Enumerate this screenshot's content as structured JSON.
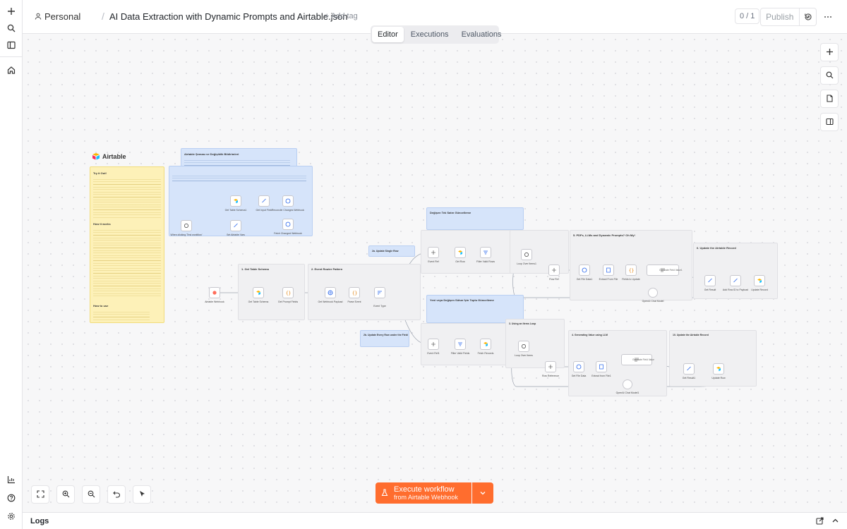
{
  "breadcrumb": {
    "project": "Personal",
    "separator": "/",
    "workflow_title": "AI Data Extraction with Dynamic Prompts and Airtable.json",
    "add_tag": "+ Add tag"
  },
  "header": {
    "version_counter": "0 / 1",
    "publish_label": "Publish"
  },
  "tabs": [
    {
      "label": "Editor",
      "active": true
    },
    {
      "label": "Executions",
      "active": false
    },
    {
      "label": "Evaluations",
      "active": false
    }
  ],
  "execute": {
    "label": "Execute workflow",
    "sublabel": "from Airtable Webhook"
  },
  "logs": {
    "label": "Logs"
  },
  "workflow": {
    "airtable_logo": "Airtable",
    "sticky_try_it": "Try it Out!",
    "sticky_how_it_works": "How it works",
    "sticky_how_to_use": "How to use",
    "sticky_airtable_sema": "Airtable Şeması ve Değişiklik Bildirimleri",
    "sticky_update_single": "2a. Update Single Row",
    "sticky_update_all": "2b. Update Every Row under the Field",
    "sticky_get_schema": "1. Get Table Schema",
    "sticky_event_router": "2. Event Router Pattern",
    "sticky_degisen_tek": "Değişen Tek Satırı Güncelleme",
    "sticky_yeni": "Yeni veya Değişen Sütun İçin Toplu Güncelleme",
    "sticky_pdf": "5. PDFs, LLMs and Dynamic Prompts? Oh My!",
    "sticky_update_record": "6. Update the Airtable Record",
    "sticky_using_items": "3. Using an Items Loop",
    "sticky_gen_values": "4. Generating Value using LLM",
    "sticky_update_rec2": "10. Update the Airtable Record",
    "nodes": [
      {
        "label": "Airtable Webhook"
      },
      {
        "label": "Get Table Schema"
      },
      {
        "label": "Get Prompt Fields"
      },
      {
        "label": "Get Webhook Payload"
      },
      {
        "label": "Parse Event"
      },
      {
        "label": "Event Type"
      },
      {
        "label": "Event Ref"
      },
      {
        "label": "Get Row"
      },
      {
        "label": "Filter Valid Rows"
      },
      {
        "label": "Loop Over Items1"
      },
      {
        "label": "Row Ref"
      },
      {
        "label": "Get File Data1"
      },
      {
        "label": "Extract From File"
      },
      {
        "label": "Fields to Update"
      },
      {
        "label": "Generate Field Value1"
      },
      {
        "label": "OpenAI Chat Model"
      },
      {
        "label": "Get Result"
      },
      {
        "label": "Add Row ID to Payload"
      },
      {
        "label": "Update Record"
      },
      {
        "label": "When clicking 'Test workflow'"
      },
      {
        "label": "Set Airtable Vars"
      },
      {
        "label": "Get Table Schema1"
      },
      {
        "label": "Get Input Field"
      },
      {
        "label": "Reconcile Changes Webhook"
      },
      {
        "label": "Fetch Changed Webhook"
      },
      {
        "label": "Event Ref1"
      },
      {
        "label": "Filter Valid Fields"
      },
      {
        "label": "Fetch Records"
      },
      {
        "label": "Loop Over Items"
      },
      {
        "label": "Row Reference"
      },
      {
        "label": "Get File Data"
      },
      {
        "label": "Extract from File1"
      },
      {
        "label": "Generate Field Value"
      },
      {
        "label": "OpenAI Chat Model1"
      },
      {
        "label": "Get Result1"
      },
      {
        "label": "Update Row"
      }
    ]
  }
}
